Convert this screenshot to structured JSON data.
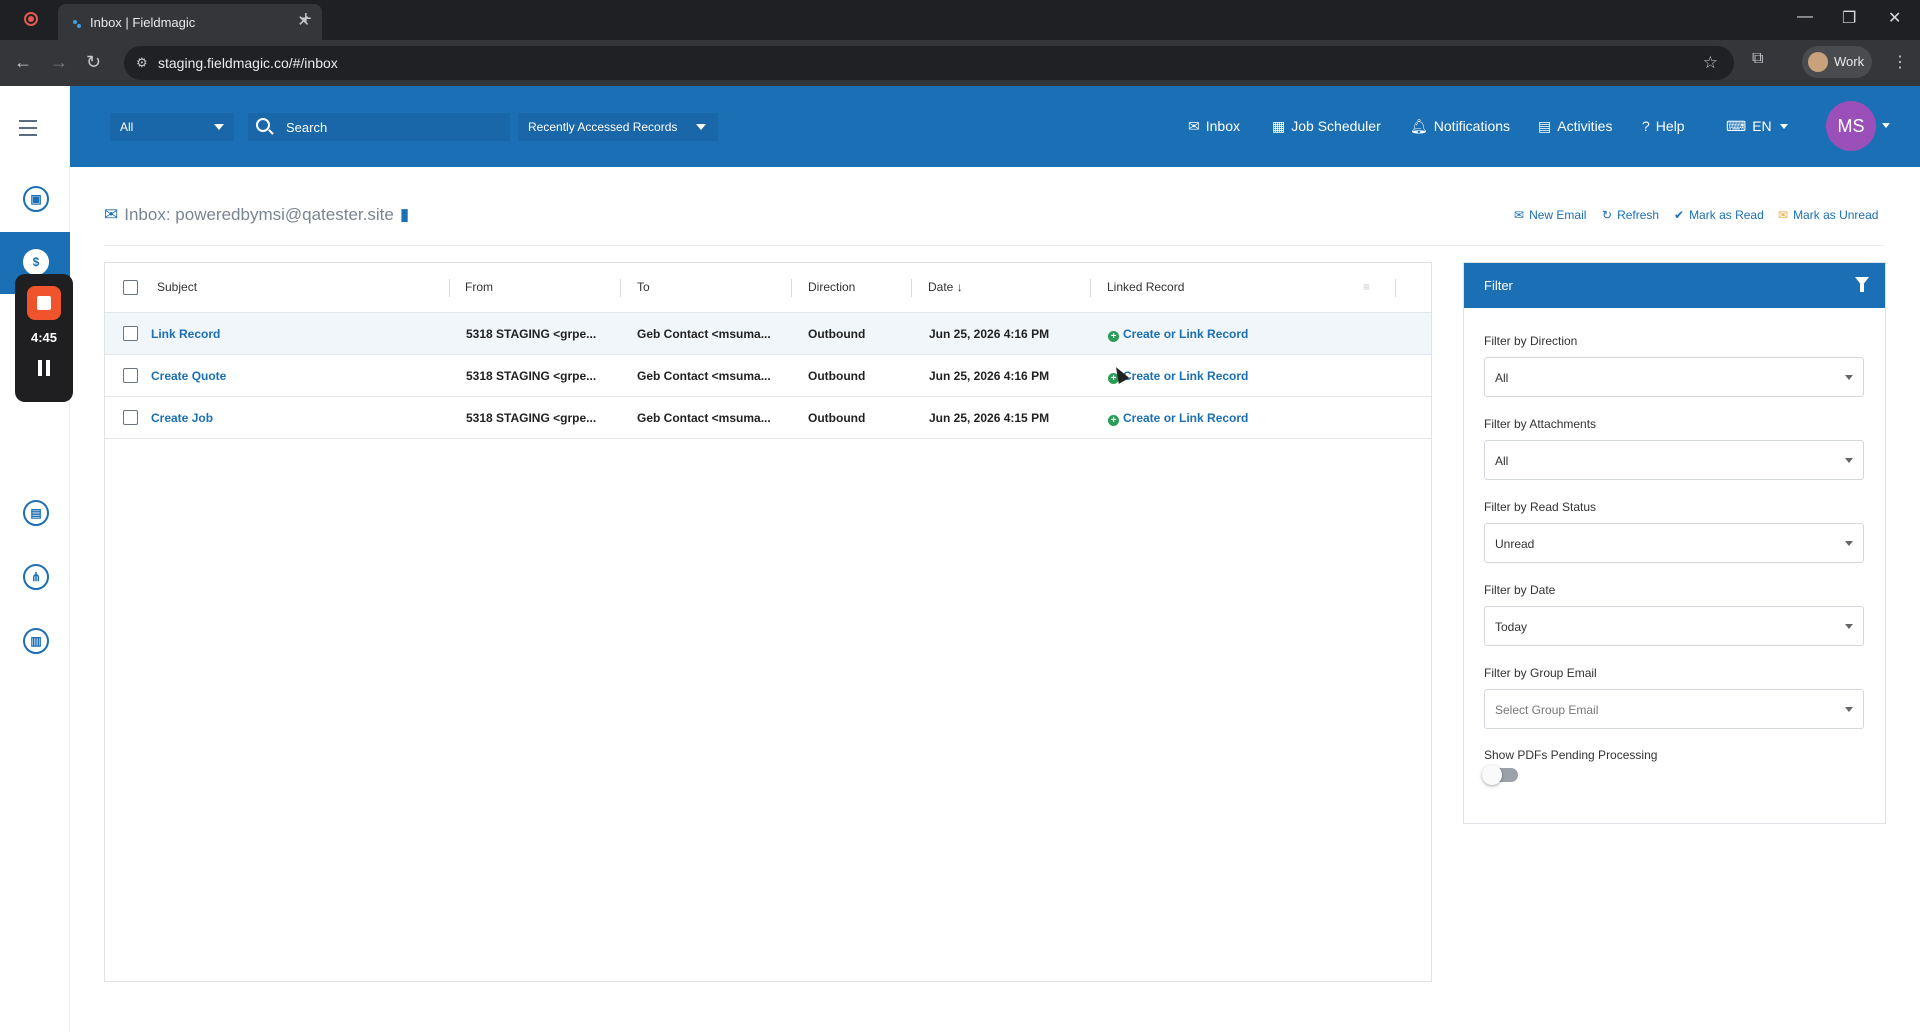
{
  "browser": {
    "tab_title": "Inbox | Fieldmagic",
    "url": "staging.fieldmagic.co/#/inbox",
    "profile_label": "Work"
  },
  "recorder": {
    "time": "4:45"
  },
  "header": {
    "scope_select": "All",
    "search_placeholder": "Search",
    "recent_records": "Recently Accessed Records",
    "nav": {
      "inbox": "Inbox",
      "job_scheduler": "Job Scheduler",
      "notifications": "Notifications",
      "activities": "Activities",
      "help": "Help",
      "language": "EN"
    },
    "avatar_initials": "MS",
    "avatar_color": "#9b4fb9",
    "brand_color": "#1b6fb5"
  },
  "page": {
    "title": "Inbox: poweredbymsi@qatester.site",
    "actions": {
      "new_email": "New Email",
      "refresh": "Refresh",
      "mark_read": "Mark as Read",
      "mark_unread": "Mark as Unread"
    }
  },
  "table": {
    "columns": [
      "Subject",
      "From",
      "To",
      "Direction",
      "Date",
      "Linked Record"
    ],
    "rows": [
      {
        "subject": "Link Record",
        "from": "5318 STAGING <grpe...",
        "to": "Geb Contact <msuma...",
        "direction": "Outbound",
        "date": "Jun 25, 2026 4:16 PM",
        "linked": "Create or Link Record"
      },
      {
        "subject": "Create Quote",
        "from": "5318 STAGING <grpe...",
        "to": "Geb Contact <msuma...",
        "direction": "Outbound",
        "date": "Jun 25, 2026 4:16 PM",
        "linked": "Create or Link Record"
      },
      {
        "subject": "Create Job",
        "from": "5318 STAGING <grpe...",
        "to": "Geb Contact <msuma...",
        "direction": "Outbound",
        "date": "Jun 25, 2026 4:15 PM",
        "linked": "Create or Link Record"
      }
    ]
  },
  "filter": {
    "title": "Filter",
    "direction_label": "Filter by Direction",
    "direction_value": "All",
    "attachments_label": "Filter by Attachments",
    "attachments_value": "All",
    "read_status_label": "Filter by Read Status",
    "read_status_value": "Unread",
    "date_label": "Filter by Date",
    "date_value": "Today",
    "group_email_label": "Filter by Group Email",
    "group_email_placeholder": "Select Group Email",
    "pdfs_label": "Show PDFs Pending Processing",
    "pdfs_toggle_on": false
  }
}
